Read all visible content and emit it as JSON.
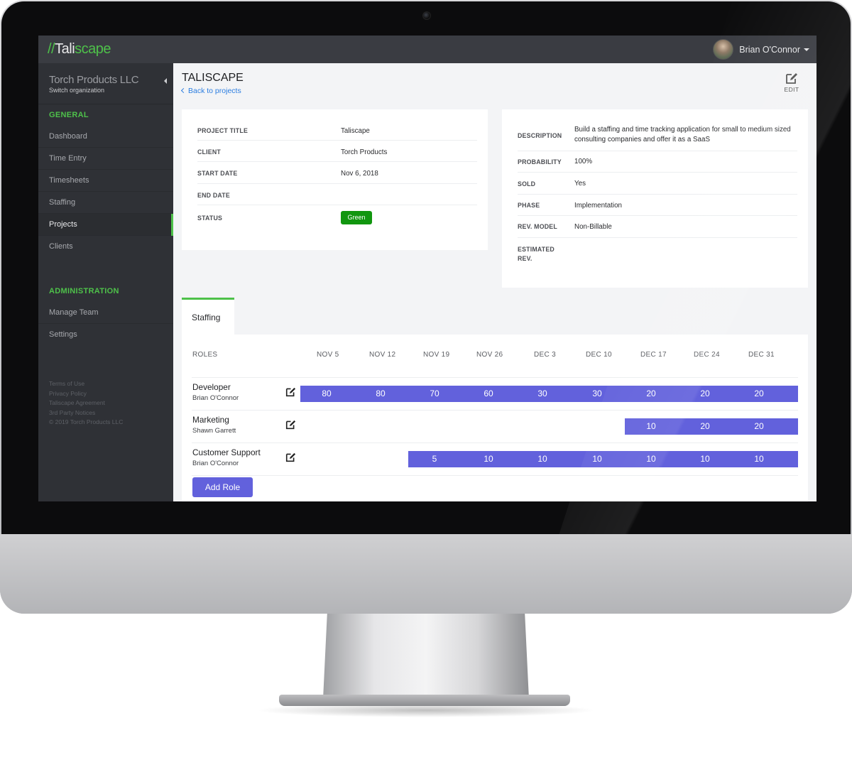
{
  "app": {
    "logo_prefix": "//",
    "logo_main": "Tali",
    "logo_accent": "scape"
  },
  "user": {
    "name": "Brian O'Connor"
  },
  "org": {
    "name": "Torch Products LLC",
    "switch_label": "Switch organization"
  },
  "sidebar": {
    "general_heading": "GENERAL",
    "general_items": [
      "Dashboard",
      "Time Entry",
      "Timesheets",
      "Staffing",
      "Projects",
      "Clients"
    ],
    "active_item": "Projects",
    "admin_heading": "ADMINISTRATION",
    "admin_items": [
      "Manage Team",
      "Settings"
    ],
    "footer": [
      "Terms of Use",
      "Privacy Policy",
      "Taliscape Agreement",
      "3rd Party Notices",
      "© 2019 Torch Products LLC"
    ]
  },
  "page": {
    "title": "TALISCAPE",
    "back_link": "Back to projects",
    "edit_label": "EDIT"
  },
  "details_left": [
    {
      "label": "PROJECT TITLE",
      "value": "Taliscape"
    },
    {
      "label": "CLIENT",
      "value": "Torch Products"
    },
    {
      "label": "START DATE",
      "value": "Nov 6, 2018"
    },
    {
      "label": "END DATE",
      "value": ""
    },
    {
      "label": "STATUS",
      "value": "Green"
    }
  ],
  "details_right": [
    {
      "label": "DESCRIPTION",
      "value": "Build a staffing and time tracking application for small to medium sized consulting companies and offer it as a SaaS"
    },
    {
      "label": "PROBABILITY",
      "value": "100%"
    },
    {
      "label": "SOLD",
      "value": "Yes"
    },
    {
      "label": "PHASE",
      "value": "Implementation"
    },
    {
      "label": "REV. MODEL",
      "value": "Non-Billable"
    },
    {
      "label": "ESTIMATED REV.",
      "value": ""
    }
  ],
  "status_color": "#11960f",
  "accent_color": "#4ec14a",
  "bar_color": "#6261dc",
  "staffing": {
    "tab_label": "Staffing",
    "roles_header": "ROLES",
    "weeks": [
      "NOV 5",
      "NOV 12",
      "NOV 19",
      "NOV 26",
      "DEC 3",
      "DEC 10",
      "DEC 17",
      "DEC 24",
      "DEC 31"
    ],
    "rows": [
      {
        "role": "Developer",
        "person": "Brian O'Connor",
        "values": [
          80,
          80,
          70,
          60,
          30,
          30,
          20,
          20,
          20
        ]
      },
      {
        "role": "Marketing",
        "person": "Shawn Garrett",
        "values": [
          null,
          null,
          null,
          null,
          null,
          null,
          10,
          20,
          20
        ]
      },
      {
        "role": "Customer Support",
        "person": "Brian O'Connor",
        "values": [
          null,
          null,
          5,
          10,
          10,
          10,
          10,
          10,
          10
        ]
      }
    ],
    "add_role_label": "Add Role"
  }
}
